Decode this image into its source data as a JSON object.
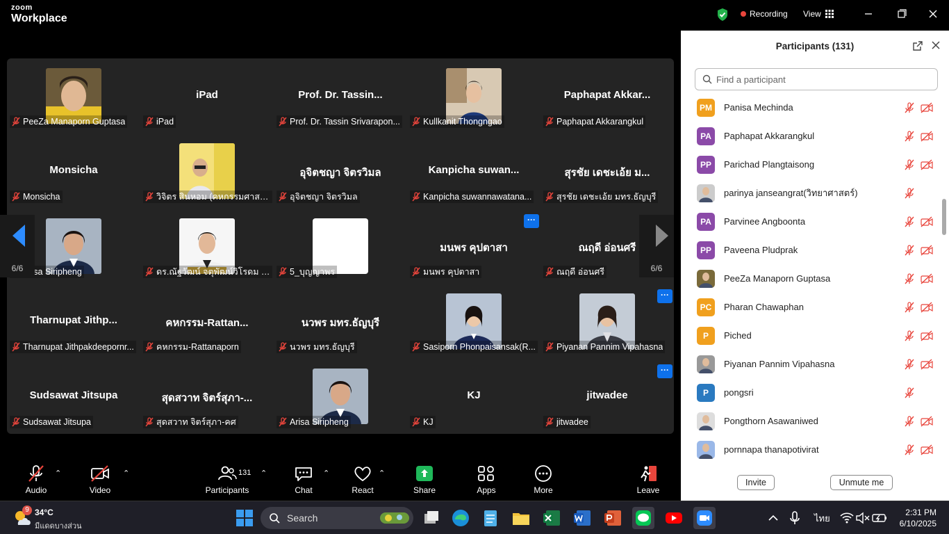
{
  "app": {
    "brand_top": "zoom",
    "brand_bottom": "Workplace",
    "recording_label": "Recording",
    "view_label": "View"
  },
  "grid": {
    "page_indicator": "6/6",
    "tiles": [
      {
        "big": "",
        "label": "PeeZa Manaporn Guptasa",
        "photo": "peeza"
      },
      {
        "big": "iPad",
        "label": "iPad"
      },
      {
        "big": "Prof. Dr. Tassin...",
        "label": "Prof. Dr. Tassin Srivarapon..."
      },
      {
        "big": "",
        "label": "Kullkanit Thongngao",
        "photo": "kullkanit"
      },
      {
        "big": "Paphapat  Akkar...",
        "label": "Paphapat Akkarangkul"
      },
      {
        "big": "Monsicha",
        "label": "Monsicha"
      },
      {
        "big": "",
        "label": "วิจิตร  สินหอม (คหกรรมศาสตร์)",
        "photo": "vijit"
      },
      {
        "big": "อุจิตชญา จิตรวิมล",
        "label": "อุจิตชญา จิตรวิมล"
      },
      {
        "big": "Kanpicha  suwan...",
        "label": "Kanpicha suwannawatana..."
      },
      {
        "big": "สุรชัย เดชะเอ้ย ม...",
        "label": "สุรชัย เดชะเอ้ย มทร.ธัญบุรี"
      },
      {
        "big": "",
        "label": "Arisa Siripheng",
        "photo": "arisa"
      },
      {
        "big": "",
        "label": "ดร.ณัฐวัฒน์ จตุพัฒน์วิโรดม คณ...",
        "photo": "nattawat"
      },
      {
        "big": "",
        "label": "5_บุญญาพร",
        "photo": "white"
      },
      {
        "big": "มนพร คุปตาสา",
        "label": "มนพร คุปตาสา"
      },
      {
        "big": "ณฤดี อ่อนศรี",
        "label": "ณฤดี อ่อนศรี"
      },
      {
        "big": "Tharnupat  Jithp...",
        "label": "Tharnupat Jithpakdeepornr..."
      },
      {
        "big": "คหกรรม-Rattan...",
        "label": "คหกรรม-Rattanaporn"
      },
      {
        "big": "นวพร มทร.ธัญบุรี",
        "label": "นวพร มทร.ธัญบุรี"
      },
      {
        "big": "",
        "label": "Sasiporn Phonpaisansak(R...",
        "photo": "sasiporn"
      },
      {
        "big": "",
        "label": "Piyanan Pannim Vipahasna",
        "photo": "piyanan"
      },
      {
        "big": "Sudsawat Jitsupa",
        "label": "Sudsawat Jitsupa"
      },
      {
        "big": "สุดสวาท จิตร์สุภา-...",
        "label": "สุดสวาท จิตร์สุภา-คศ"
      },
      {
        "big": "",
        "label": "Arisa Siripheng",
        "photo": "arisa"
      },
      {
        "big": "KJ",
        "label": "KJ"
      },
      {
        "big": "jitwadee",
        "label": "jitwadee"
      }
    ]
  },
  "toolbar": {
    "audio": "Audio",
    "video": "Video",
    "participants": "Participants",
    "participants_count": "131",
    "chat": "Chat",
    "react": "React",
    "share": "Share",
    "apps": "Apps",
    "more": "More",
    "leave": "Leave",
    "share_color": "#1fb85a",
    "leave_color": "#e8453c"
  },
  "panel": {
    "title": "Participants (131)",
    "search_placeholder": "Find a participant",
    "invite": "Invite",
    "unmute_me": "Unmute me",
    "participants": [
      {
        "initials": "PM",
        "color": "#f0a01e",
        "name": "Panisa Mechinda",
        "cam": true
      },
      {
        "initials": "PA",
        "color": "#8b4aa8",
        "name": "Paphapat Akkarangkul",
        "cam": true
      },
      {
        "initials": "PP",
        "color": "#8b4aa8",
        "name": "Parichad Plangtaisong",
        "cam": true
      },
      {
        "initials": "",
        "color": "#ccc",
        "name": "parinya janseangrat(วิทยาศาสตร์)",
        "cam": false,
        "photo": true
      },
      {
        "initials": "PA",
        "color": "#8b4aa8",
        "name": "Parvinee Angboonta",
        "cam": true
      },
      {
        "initials": "PP",
        "color": "#8b4aa8",
        "name": "Paveena  Pludprak",
        "cam": true
      },
      {
        "initials": "",
        "color": "#7a6a3a",
        "name": "PeeZa Manaporn Guptasa",
        "cam": true,
        "photo": true
      },
      {
        "initials": "PC",
        "color": "#f0a01e",
        "name": "Pharan Chawaphan",
        "cam": true
      },
      {
        "initials": "P",
        "color": "#f0a01e",
        "name": "Piched",
        "cam": true
      },
      {
        "initials": "",
        "color": "#999",
        "name": "Piyanan Pannim Vipahasna",
        "cam": true,
        "photo": true
      },
      {
        "initials": "P",
        "color": "#2a7ac0",
        "name": "pongsri",
        "cam": false
      },
      {
        "initials": "",
        "color": "#ddd",
        "name": "Pongthorn Asawaniwed",
        "cam": true,
        "photo": true
      },
      {
        "initials": "",
        "color": "#9ab8e8",
        "name": "pornnapa thanapotivirat",
        "cam": true,
        "photo": true
      }
    ]
  },
  "taskbar": {
    "temp": "34°C",
    "condition": "มีแดดบางส่วน",
    "weather_badge": "9",
    "search": "Search",
    "lang": "ไทย",
    "time": "2:31 PM",
    "date": "6/10/2025"
  }
}
